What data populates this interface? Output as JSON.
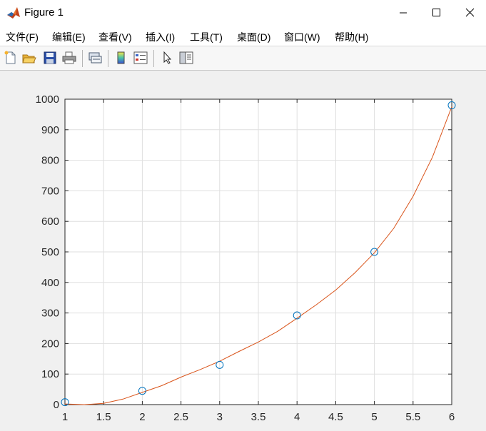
{
  "window": {
    "title": "Figure 1",
    "controls": {
      "minimize": "minimize",
      "maximize": "maximize",
      "close": "close"
    }
  },
  "menu": {
    "items": [
      {
        "id": "file",
        "label": "文件(F)"
      },
      {
        "id": "edit",
        "label": "编辑(E)"
      },
      {
        "id": "view",
        "label": "查看(V)"
      },
      {
        "id": "insert",
        "label": "插入(I)"
      },
      {
        "id": "tools",
        "label": "工具(T)"
      },
      {
        "id": "desktop",
        "label": "桌面(D)"
      },
      {
        "id": "window",
        "label": "窗口(W)"
      },
      {
        "id": "help",
        "label": "帮助(H)"
      }
    ]
  },
  "toolbar": {
    "buttons": [
      {
        "id": "new",
        "icon": "new-figure-icon"
      },
      {
        "id": "open",
        "icon": "open-folder-icon"
      },
      {
        "id": "save",
        "icon": "save-icon"
      },
      {
        "id": "print",
        "icon": "print-icon"
      },
      {
        "id": "link",
        "icon": "link-plot-icon"
      },
      {
        "id": "colorbar",
        "icon": "colorbar-icon"
      },
      {
        "id": "legend",
        "icon": "legend-icon"
      },
      {
        "id": "select",
        "icon": "arrow-cursor-icon"
      },
      {
        "id": "property",
        "icon": "property-inspector-icon"
      }
    ]
  },
  "colors": {
    "axes_background": "#ffffff",
    "grid": "#dfdfdf",
    "axis": "#262626",
    "marker": "#0072bd",
    "curve": "#d95319"
  },
  "chart_data": {
    "type": "scatter",
    "title": "",
    "xlabel": "",
    "ylabel": "",
    "xlim": [
      1,
      6
    ],
    "ylim": [
      0,
      1000
    ],
    "xticks": [
      1,
      1.5,
      2,
      2.5,
      3,
      3.5,
      4,
      4.5,
      5,
      5.5,
      6
    ],
    "yticks": [
      0,
      100,
      200,
      300,
      400,
      500,
      600,
      700,
      800,
      900,
      1000
    ],
    "grid": true,
    "series": [
      {
        "type": "scatter",
        "marker": "circle-open",
        "x": [
          1,
          2,
          3,
          4,
          5,
          6
        ],
        "y": [
          8,
          45,
          130,
          292,
          500,
          980
        ]
      },
      {
        "type": "line",
        "x": [
          1,
          1.25,
          1.5,
          1.75,
          2,
          2.25,
          2.5,
          2.75,
          3,
          3.25,
          3.5,
          3.75,
          4,
          4.25,
          4.5,
          4.75,
          5,
          5.25,
          5.5,
          5.75,
          6
        ],
        "y": [
          2,
          0,
          4,
          18,
          40,
          62,
          90,
          115,
          142,
          174,
          205,
          240,
          283,
          327,
          375,
          432,
          497,
          577,
          682,
          810,
          975
        ]
      }
    ]
  }
}
